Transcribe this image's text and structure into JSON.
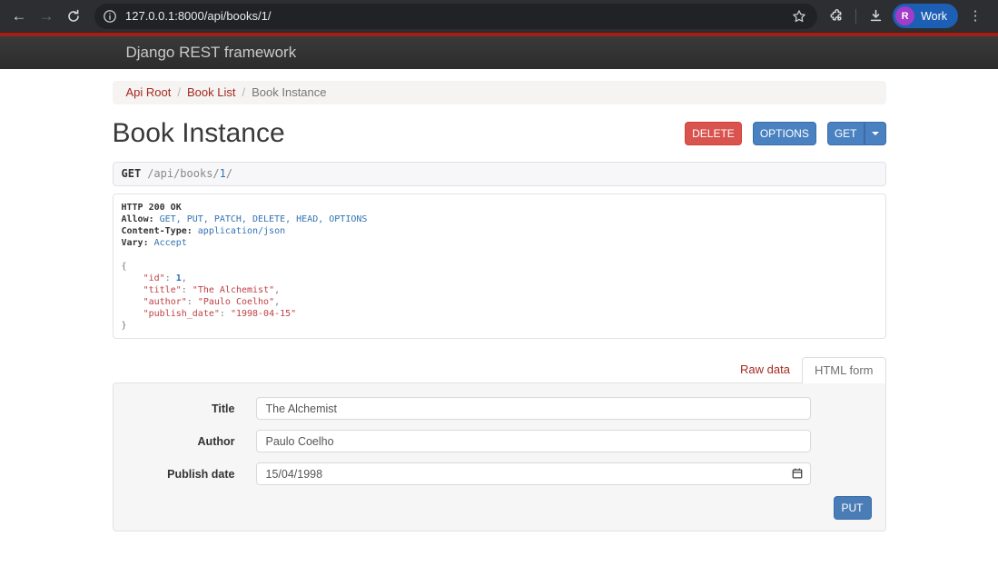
{
  "colors": {
    "accent_stripe": "#9A241B",
    "link_red": "#A5291F",
    "button_blue": "#4A81C1",
    "button_red": "#D9534F",
    "json_key_red": "#BF4045",
    "token_blue": "#2A6DB4",
    "profile_chip_blue": "#1D5FB5",
    "avatar_purple": "#A23CCB"
  },
  "browser": {
    "url": "127.0.0.1:8000/api/books/1/",
    "profile": {
      "initial": "R",
      "name": "Work"
    }
  },
  "navbar": {
    "brand": "Django REST framework"
  },
  "breadcrumb": {
    "separator": "/",
    "items": [
      {
        "label": "Api Root"
      },
      {
        "label": "Book List"
      },
      {
        "label": "Book Instance"
      }
    ]
  },
  "page": {
    "title": "Book Instance",
    "actions": {
      "delete_label": "DELETE",
      "options_label": "OPTIONS",
      "get_label": "GET"
    }
  },
  "request_line": {
    "method": "GET",
    "path_prefix": "/api/books/",
    "path_id": "1",
    "path_suffix": "/"
  },
  "response": {
    "status_line": "HTTP 200 OK",
    "headers": [
      {
        "name": "Allow:",
        "value": "GET, PUT, PATCH, DELETE, HEAD, OPTIONS"
      },
      {
        "name": "Content-Type:",
        "value": "application/json"
      },
      {
        "name": "Vary:",
        "value": "Accept"
      }
    ],
    "json_body": {
      "open_brace": "{",
      "close_brace": "}",
      "indent": "    ",
      "colon": ": ",
      "entries": [
        {
          "key": "\"id\"",
          "value": "1",
          "value_class": "tok-num",
          "comma": ","
        },
        {
          "key": "\"title\"",
          "value": "\"The Alchemist\"",
          "value_class": "tok-str",
          "comma": ","
        },
        {
          "key": "\"author\"",
          "value": "\"Paulo Coelho\"",
          "value_class": "tok-str",
          "comma": ","
        },
        {
          "key": "\"publish_date\"",
          "value": "\"1998-04-15\"",
          "value_class": "tok-str",
          "comma": ""
        }
      ]
    }
  },
  "tabs": {
    "raw_label": "Raw data",
    "html_label": "HTML form"
  },
  "form": {
    "fields": [
      {
        "label": "Title",
        "value": "The Alchemist"
      },
      {
        "label": "Author",
        "value": "Paulo Coelho"
      },
      {
        "label": "Publish date",
        "value": "15/04/1998"
      }
    ],
    "submit_label": "PUT"
  }
}
